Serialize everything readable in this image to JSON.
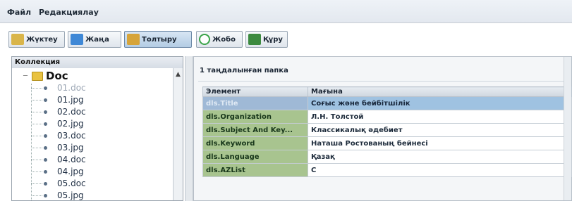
{
  "menu": {
    "items": [
      "Файл",
      "Редакциялау"
    ]
  },
  "toolbar": {
    "buttons": [
      {
        "label": "Жүктеу",
        "icon": "open-folder-icon"
      },
      {
        "label": "Жаңа",
        "icon": "new-document-icon"
      },
      {
        "label": "Толтыру",
        "icon": "edit-icon"
      },
      {
        "label": "Жобо",
        "icon": "refresh-icon"
      },
      {
        "label": "Құру",
        "icon": "save-icon"
      }
    ],
    "active_button": "Толтыру"
  },
  "collection": {
    "title": "Коллекция",
    "root": "Doc",
    "items": [
      "01.doc",
      "01.jpg",
      "02.doc",
      "02.jpg",
      "03.doc",
      "03.jpg",
      "04.doc",
      "04.jpg",
      "05.doc",
      "05.jpg"
    ],
    "selected_item": "01.doc"
  },
  "main": {
    "selected_title": "1 таңдалынған папка",
    "table": {
      "headers": [
        "Элемент",
        "Мағына"
      ],
      "rows": [
        {
          "element": "dls.Title",
          "value": "Соғыс және бейбітшілік"
        },
        {
          "element": "dls.Organization",
          "value": "Л.Н. Толстой"
        },
        {
          "element": "dls.Subject And Key...",
          "value": "Классикалық әдебиет"
        },
        {
          "element": "dls.Keyword",
          "value": "Наташа Ростованың бейнесі"
        },
        {
          "element": "dls.Language",
          "value": "Қазақ"
        },
        {
          "element": "dls.AZList",
          "value": "С"
        }
      ],
      "selected_row": 0
    }
  }
}
